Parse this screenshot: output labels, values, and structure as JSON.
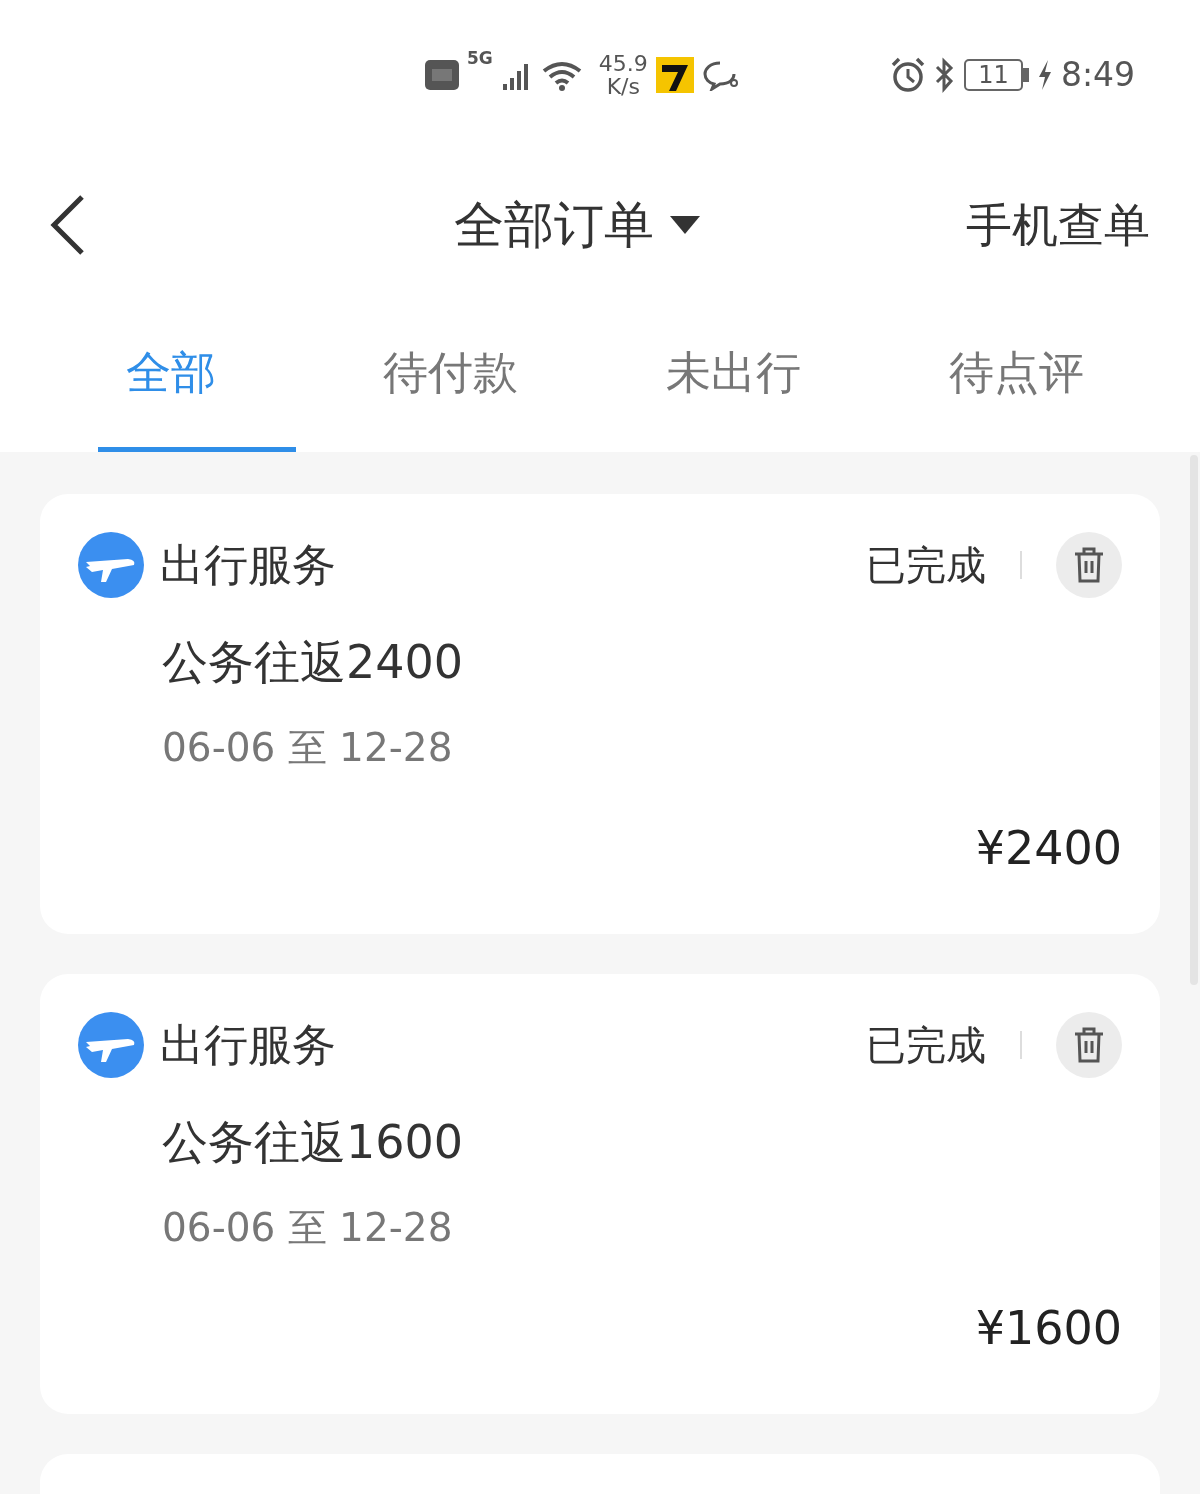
{
  "status_bar": {
    "network": "5G",
    "speed_value": "45.9",
    "speed_unit": "K/s",
    "battery": "11",
    "time": "8:49"
  },
  "header": {
    "title": "全部订单",
    "action": "手机查单"
  },
  "tabs": [
    {
      "label": "全部",
      "selected": true
    },
    {
      "label": "待付款",
      "selected": false
    },
    {
      "label": "未出行",
      "selected": false
    },
    {
      "label": "待点评",
      "selected": false
    }
  ],
  "orders": [
    {
      "category": "出行服务",
      "status": "已完成",
      "name": "公务往返2400",
      "dates": "06-06 至 12-28",
      "price": "¥2400"
    },
    {
      "category": "出行服务",
      "status": "已完成",
      "name": "公务往返1600",
      "dates": "06-06 至 12-28",
      "price": "¥1600"
    }
  ]
}
